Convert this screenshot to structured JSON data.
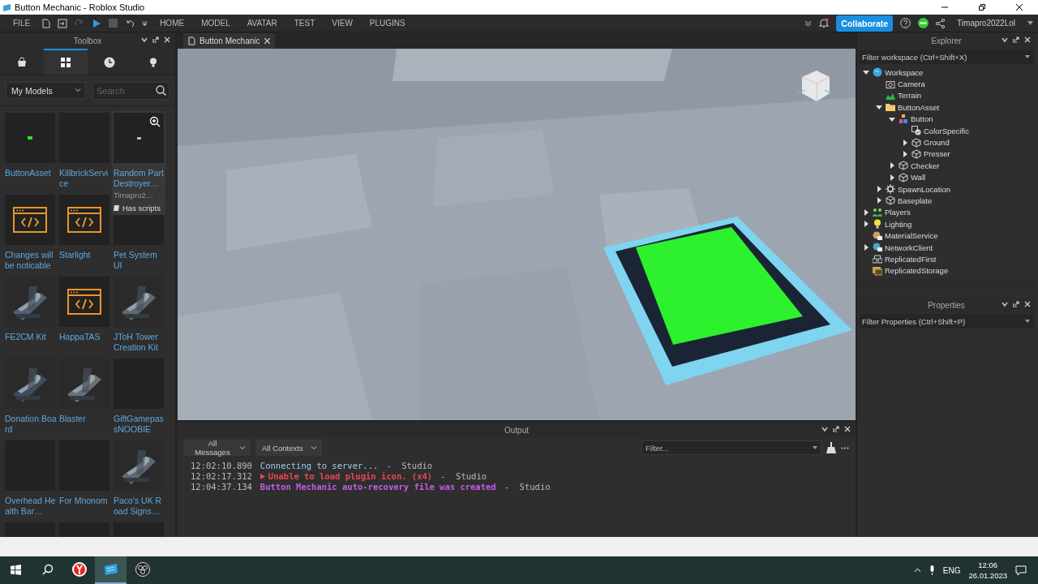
{
  "window": {
    "title": "Button Mechanic - Roblox Studio"
  },
  "menu": {
    "file": "FILE",
    "tabs": [
      {
        "label": "HOME"
      },
      {
        "label": "MODEL"
      },
      {
        "label": "AVATAR"
      },
      {
        "label": "TEST"
      },
      {
        "label": "VIEW"
      },
      {
        "label": "PLUGINS"
      }
    ],
    "collaborate": "Collaborate",
    "user": "Timapro2022Lol"
  },
  "toolbox": {
    "title": "Toolbox",
    "tabs": [
      {
        "kind": "bag",
        "selected": false
      },
      {
        "kind": "grid",
        "selected": true
      },
      {
        "kind": "clock",
        "selected": false
      },
      {
        "kind": "bulb",
        "selected": false
      }
    ],
    "category": "My Models",
    "search": {
      "placeholder": "Search"
    },
    "items": [
      {
        "name": "ButtonAsset",
        "kind": "dot"
      },
      {
        "name": "KillbrickService",
        "kind": "blank"
      },
      {
        "name": "Random Part Destroyer…",
        "kind": "speck",
        "hovered": true,
        "creator": "Timapro2…",
        "badge": "Has scripts"
      },
      {
        "name": "Changes will be noticable",
        "kind": "code"
      },
      {
        "name": "Starlight",
        "kind": "code"
      },
      {
        "name": "Pet System UI",
        "kind": "blank"
      },
      {
        "name": "FE2CM Kit",
        "kind": "picture"
      },
      {
        "name": "HappaTAS",
        "kind": "code"
      },
      {
        "name": "JToH Tower Creation Kit",
        "kind": "picture"
      },
      {
        "name": "Donation Board",
        "kind": "picture"
      },
      {
        "name": "Blaster",
        "kind": "picture"
      },
      {
        "name": "GiftGamepassNOOBIE",
        "kind": "blank"
      },
      {
        "name": "Overhead Health Bar…",
        "kind": "blank"
      },
      {
        "name": "For Mnonom",
        "kind": "blank"
      },
      {
        "name": "Paco's UK Road Signs…",
        "kind": "picture"
      }
    ]
  },
  "editor": {
    "tab": "Button Mechanic"
  },
  "output": {
    "title": "Output",
    "messages_filter": "All Messages",
    "contexts_filter": "All Contexts",
    "filter": {
      "placeholder": "Filter..."
    },
    "lines": [
      {
        "time": "12:02:10.890",
        "kind": "info",
        "text": "Connecting to server...",
        "source": "-  Studio"
      },
      {
        "time": "12:02:17.312",
        "kind": "error",
        "text": "Unable to load plugin icon. (x4)",
        "source": "-  Studio"
      },
      {
        "time": "12:04:37.134",
        "kind": "notice",
        "text": "Button Mechanic auto-recovery file was created",
        "source": "-  Studio"
      }
    ]
  },
  "explorer": {
    "title": "Explorer",
    "filter": {
      "placeholder": "Filter workspace (Ctrl+Shift+X)"
    },
    "tree": [
      {
        "name": "Workspace",
        "kind": "workspace",
        "expanded": true,
        "children": [
          {
            "name": "Camera",
            "kind": "camera"
          },
          {
            "name": "Terrain",
            "kind": "terrain"
          },
          {
            "name": "ButtonAsset",
            "kind": "folder",
            "expanded": true,
            "children": [
              {
                "name": "Button",
                "kind": "model",
                "expanded": true,
                "children": [
                  {
                    "name": "ColorSpecific",
                    "kind": "value"
                  },
                  {
                    "name": "Ground",
                    "kind": "part",
                    "expanded": false
                  },
                  {
                    "name": "Presser",
                    "kind": "part",
                    "expanded": false
                  }
                ]
              },
              {
                "name": "Checker",
                "kind": "part",
                "expanded": false
              },
              {
                "name": "Wall",
                "kind": "part",
                "expanded": false
              }
            ]
          },
          {
            "name": "SpawnLocation",
            "kind": "spawn",
            "expanded": false
          },
          {
            "name": "Baseplate",
            "kind": "part",
            "expanded": false
          }
        ]
      },
      {
        "name": "Players",
        "kind": "players",
        "expanded": false
      },
      {
        "name": "Lighting",
        "kind": "lighting",
        "expanded": false
      },
      {
        "name": "MaterialService",
        "kind": "service"
      },
      {
        "name": "NetworkClient",
        "kind": "network",
        "expanded": false
      },
      {
        "name": "ReplicatedFirst",
        "kind": "first"
      },
      {
        "name": "ReplicatedStorage",
        "kind": "storage"
      }
    ]
  },
  "properties": {
    "title": "Properties",
    "filter": {
      "placeholder": "Filter Properties (Ctrl+Shift+P)"
    }
  },
  "taskbar": {
    "apps": [
      {
        "kind": "browser",
        "selected": false
      },
      {
        "kind": "studio",
        "selected": true
      },
      {
        "kind": "recorder",
        "selected": false
      }
    ],
    "language": "ENG",
    "time": "12:06",
    "date": "26.01.2023"
  }
}
